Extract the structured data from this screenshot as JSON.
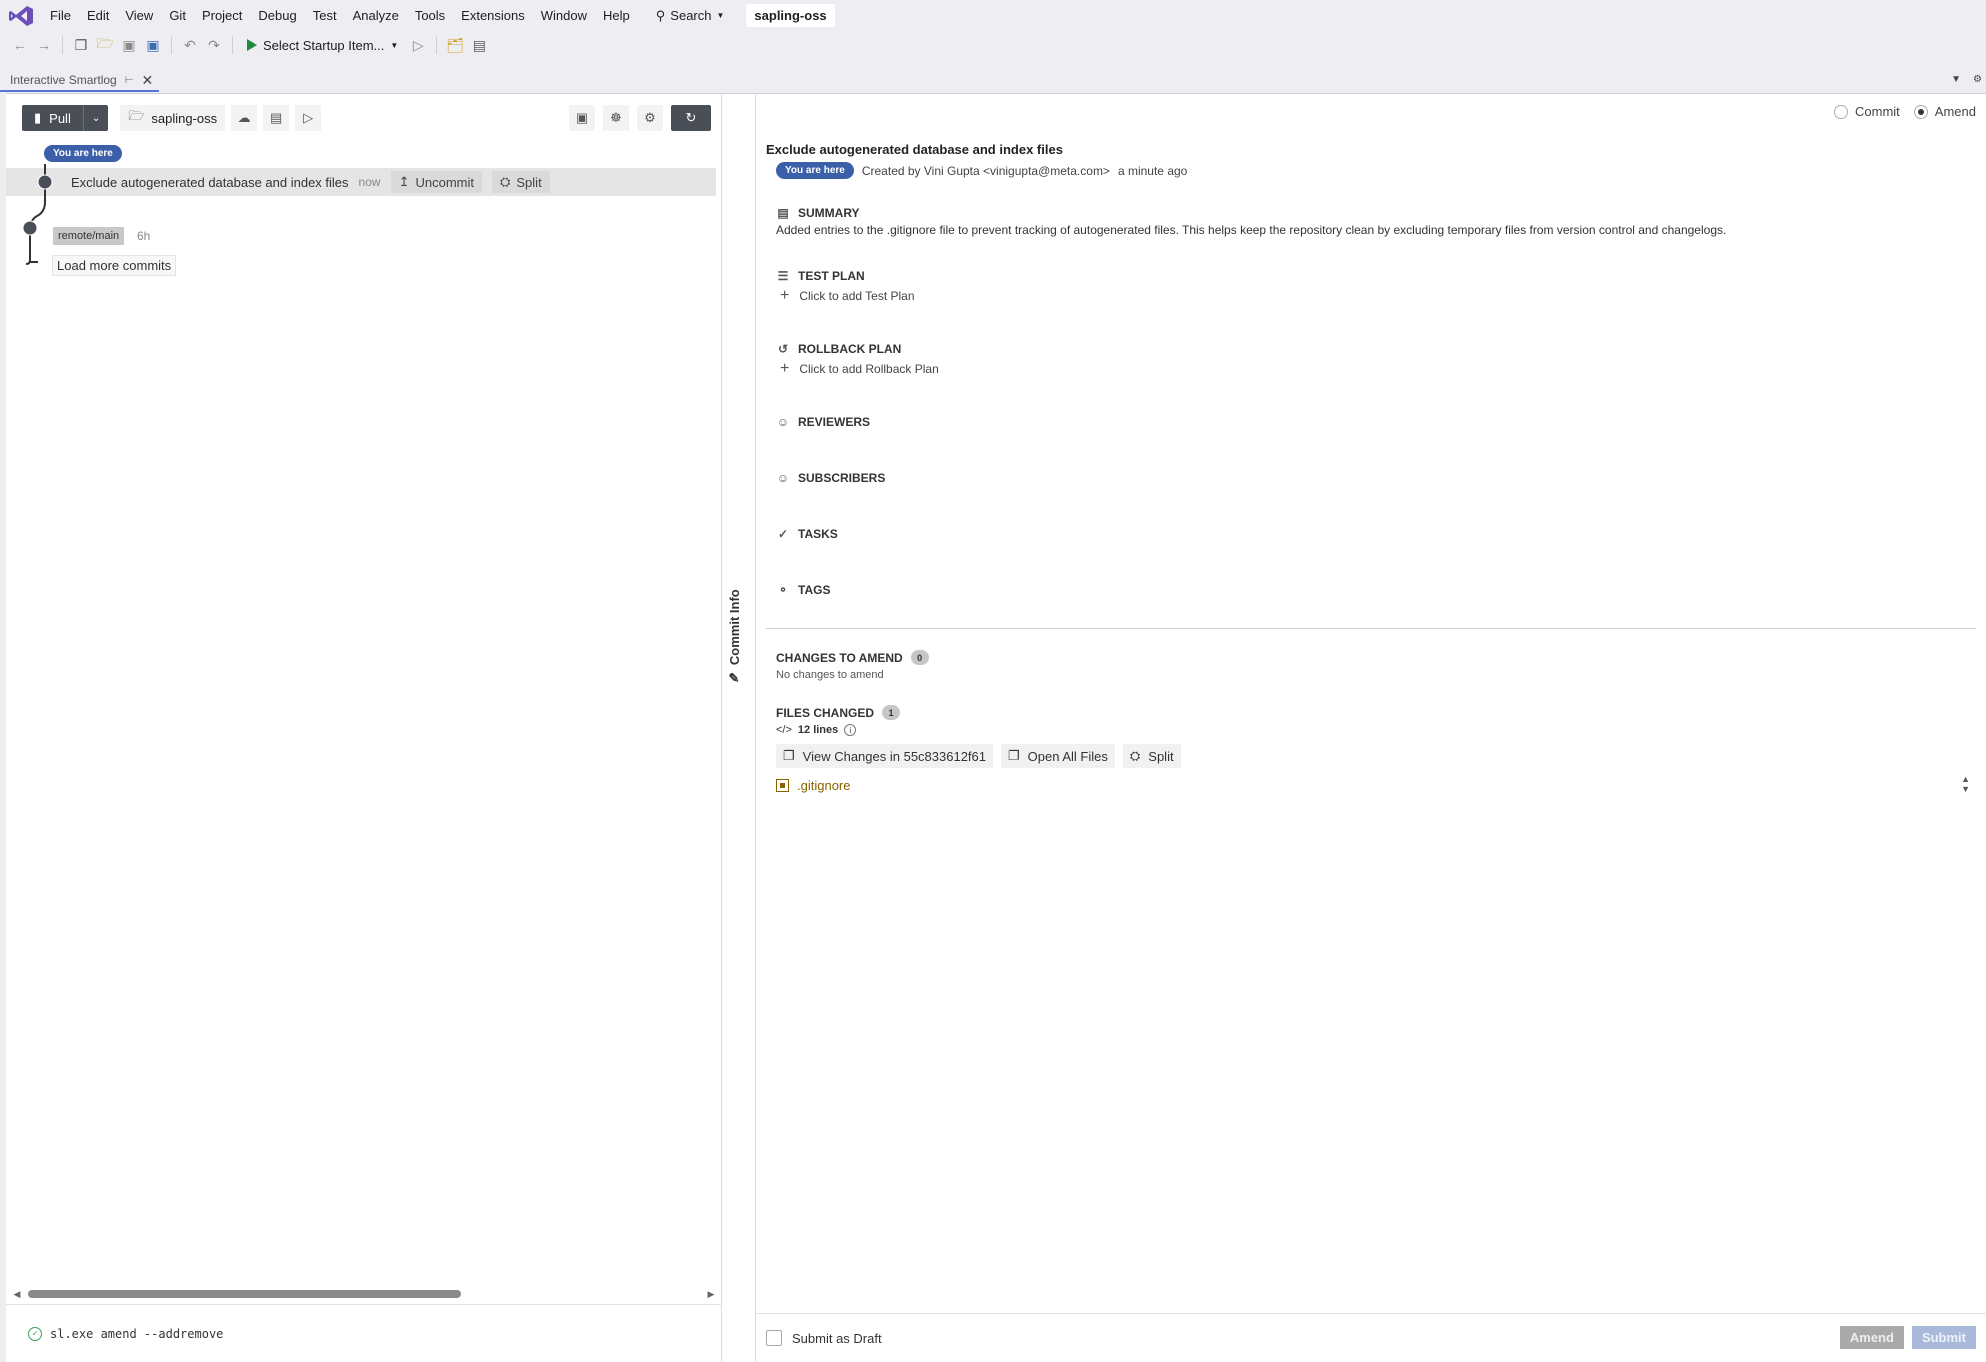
{
  "menu": {
    "items": [
      "File",
      "Edit",
      "View",
      "Git",
      "Project",
      "Debug",
      "Test",
      "Analyze",
      "Tools",
      "Extensions",
      "Window",
      "Help"
    ],
    "search_label": "Search",
    "solution_name": "sapling-oss"
  },
  "toolbar": {
    "startup_label": "Select Startup Item..."
  },
  "doc_tab": {
    "label": "Interactive Smartlog"
  },
  "smartlog": {
    "pull_label": "Pull",
    "repo_label": "sapling-oss",
    "you_are_here": "You are here",
    "commit": {
      "title": "Exclude autogenerated database and index files",
      "time": "now",
      "uncommit_label": "Uncommit",
      "split_label": "Split"
    },
    "remote": {
      "label": "remote/main",
      "time": "6h"
    },
    "load_more": "Load more commits",
    "terminal_command": "sl.exe amend --addremove"
  },
  "side_tab": {
    "label": "Commit Info"
  },
  "commit_info": {
    "mode_commit": "Commit",
    "mode_amend": "Amend",
    "title": "Exclude autogenerated database and index files",
    "you_are_here": "You are here",
    "created_by": "Created by Vini Gupta <vinigupta@meta.com>",
    "created_time": "a minute ago",
    "summary_head": "SUMMARY",
    "summary_text": "Added entries to the .gitignore file to prevent tracking of autogenerated files. This helps keep the repository clean by excluding temporary files from version control and changelogs.",
    "test_plan_head": "TEST PLAN",
    "test_plan_add": "Click to add Test Plan",
    "rollback_head": "ROLLBACK PLAN",
    "rollback_add": "Click to add Rollback Plan",
    "reviewers_head": "REVIEWERS",
    "subscribers_head": "SUBSCRIBERS",
    "tasks_head": "TASKS",
    "tags_head": "TAGS",
    "changes_head": "CHANGES TO AMEND",
    "changes_count": "0",
    "changes_empty": "No changes to amend",
    "files_head": "FILES CHANGED",
    "files_count": "1",
    "lines_label": "12 lines",
    "view_changes_label": "View Changes in 55c833612f61",
    "open_all_label": "Open All Files",
    "split_label": "Split",
    "file_name": ".gitignore",
    "draft_label": "Submit as Draft",
    "amend_btn": "Amend",
    "submit_btn": "Submit"
  }
}
